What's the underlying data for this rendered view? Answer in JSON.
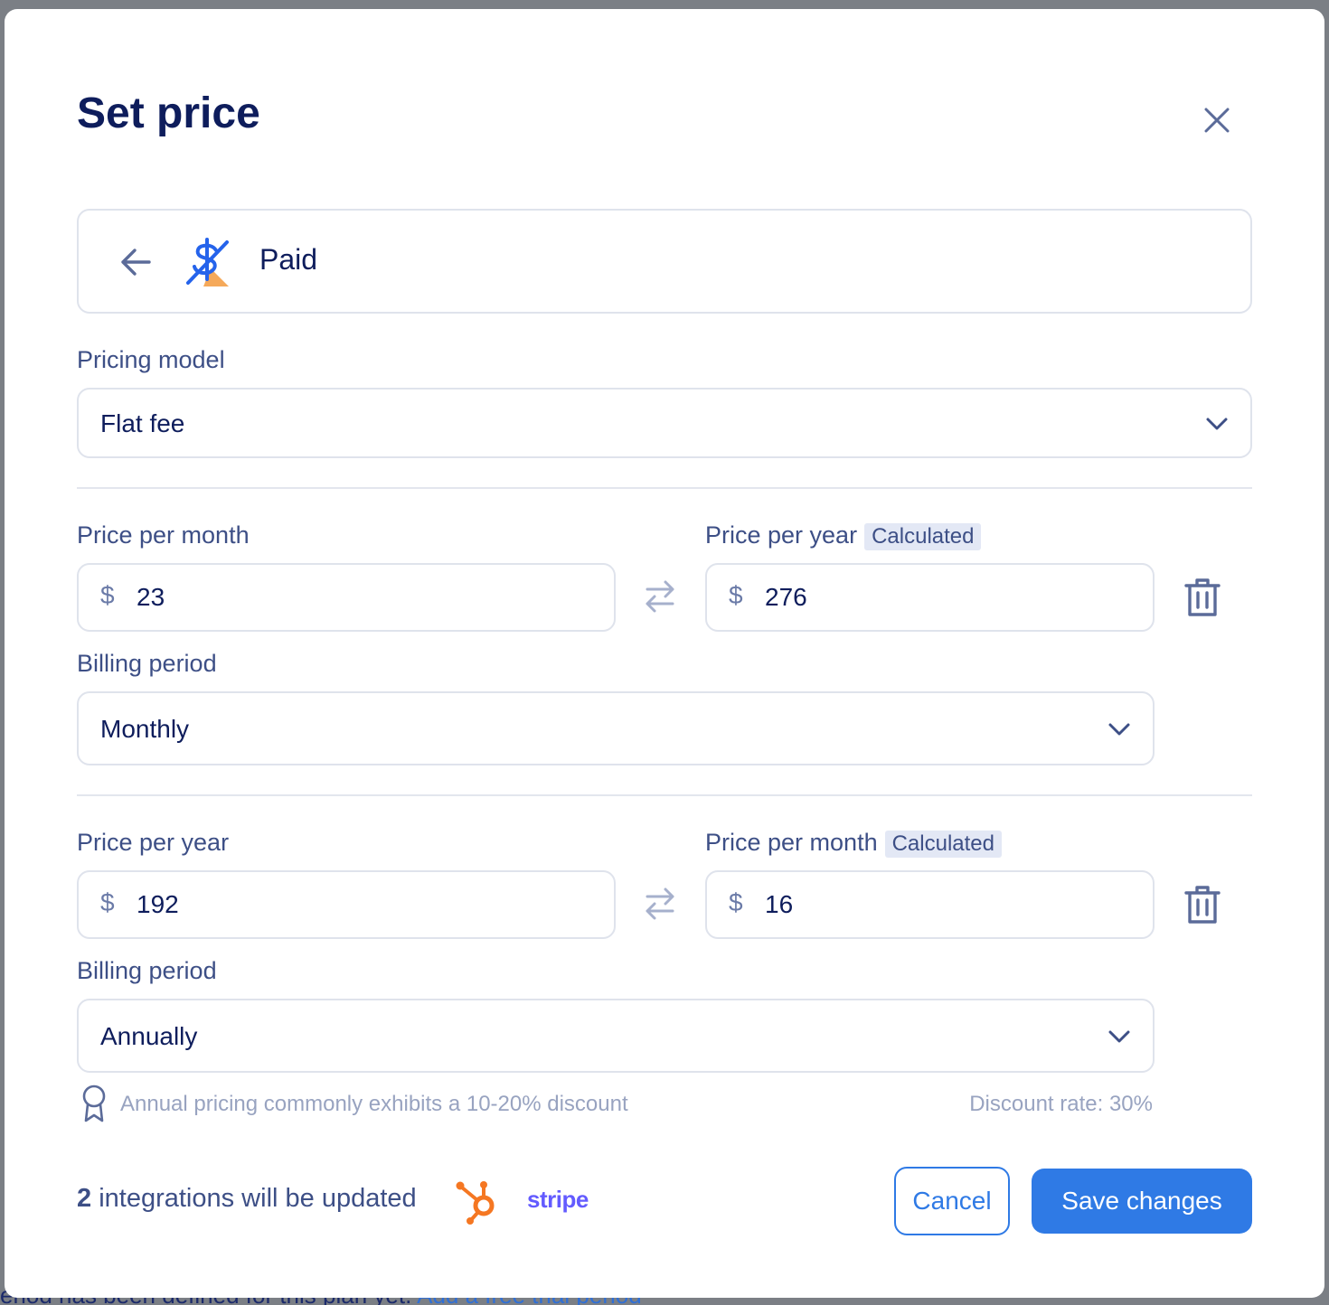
{
  "background": {
    "text": "eriod has been defined for this plan yet.",
    "link": "Add a free trial period"
  },
  "modal": {
    "title": "Set price",
    "close_icon": "close-icon"
  },
  "plan": {
    "name": "Paid",
    "back_icon": "arrow-left-icon",
    "icon": "paid-dollar-icon"
  },
  "pricing_model": {
    "label": "Pricing model",
    "value": "Flat fee"
  },
  "price_blocks": [
    {
      "primary_label": "Price per month",
      "primary_value": "23",
      "secondary_label": "Price per year",
      "secondary_badge": "Calculated",
      "secondary_value": "276",
      "currency": "$",
      "billing_label": "Billing period",
      "billing_value": "Monthly"
    },
    {
      "primary_label": "Price per year",
      "primary_value": "192",
      "secondary_label": "Price per month",
      "secondary_badge": "Calculated",
      "secondary_value": "16",
      "currency": "$",
      "billing_label": "Billing period",
      "billing_value": "Annually"
    }
  ],
  "hint": {
    "text": "Annual pricing commonly exhibits a 10-20% discount",
    "discount": "Discount rate: 30%"
  },
  "footer": {
    "integrations_count": "2",
    "integrations_text": " integrations will be updated",
    "stripe_label": "stripe",
    "cancel_label": "Cancel",
    "save_label": "Save changes"
  },
  "colors": {
    "primary": "#2f7ae5",
    "title": "#0e1d5c",
    "hubspot": "#f57722",
    "stripe": "#635bff"
  }
}
